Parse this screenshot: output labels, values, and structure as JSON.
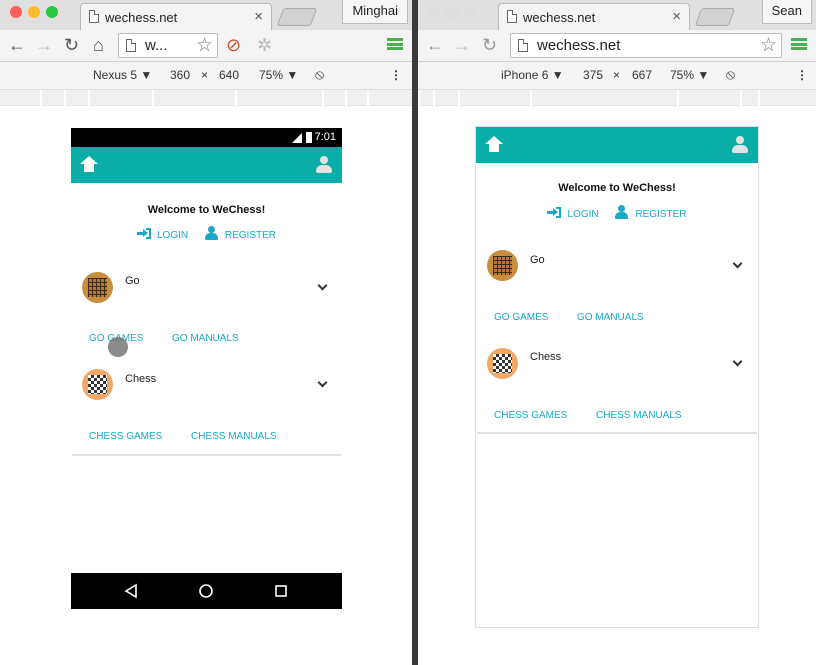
{
  "left_window": {
    "tab_title": "wechess.net",
    "profile_name": "Minghai",
    "address": "w...",
    "device": {
      "name": "Nexus 5",
      "width": "360",
      "height": "640",
      "zoom": "75%"
    },
    "status_time": "7:01"
  },
  "right_window": {
    "tab_title": "wechess.net",
    "profile_name": "Sean",
    "address": "wechess.net",
    "device": {
      "name": "iPhone 6",
      "width": "375",
      "height": "667",
      "zoom": "75%"
    }
  },
  "app": {
    "welcome": "Welcome to WeChess!",
    "login": "LOGIN",
    "register": "REGISTER",
    "games": [
      {
        "name": "Go",
        "links": [
          "GO GAMES",
          "GO MANUALS"
        ]
      },
      {
        "name": "Chess",
        "links": [
          "CHESS GAMES",
          "CHESS MANUALS"
        ]
      }
    ]
  },
  "icons": [
    "back-icon",
    "forward-icon",
    "reload-icon",
    "home-icon",
    "star-icon",
    "menu-icon",
    "user-icon",
    "login-icon",
    "register-icon",
    "chevron-down-icon",
    "rotate-icon"
  ],
  "colors": {
    "appbar": "#0aaea6",
    "link": "#1aa8c8"
  }
}
